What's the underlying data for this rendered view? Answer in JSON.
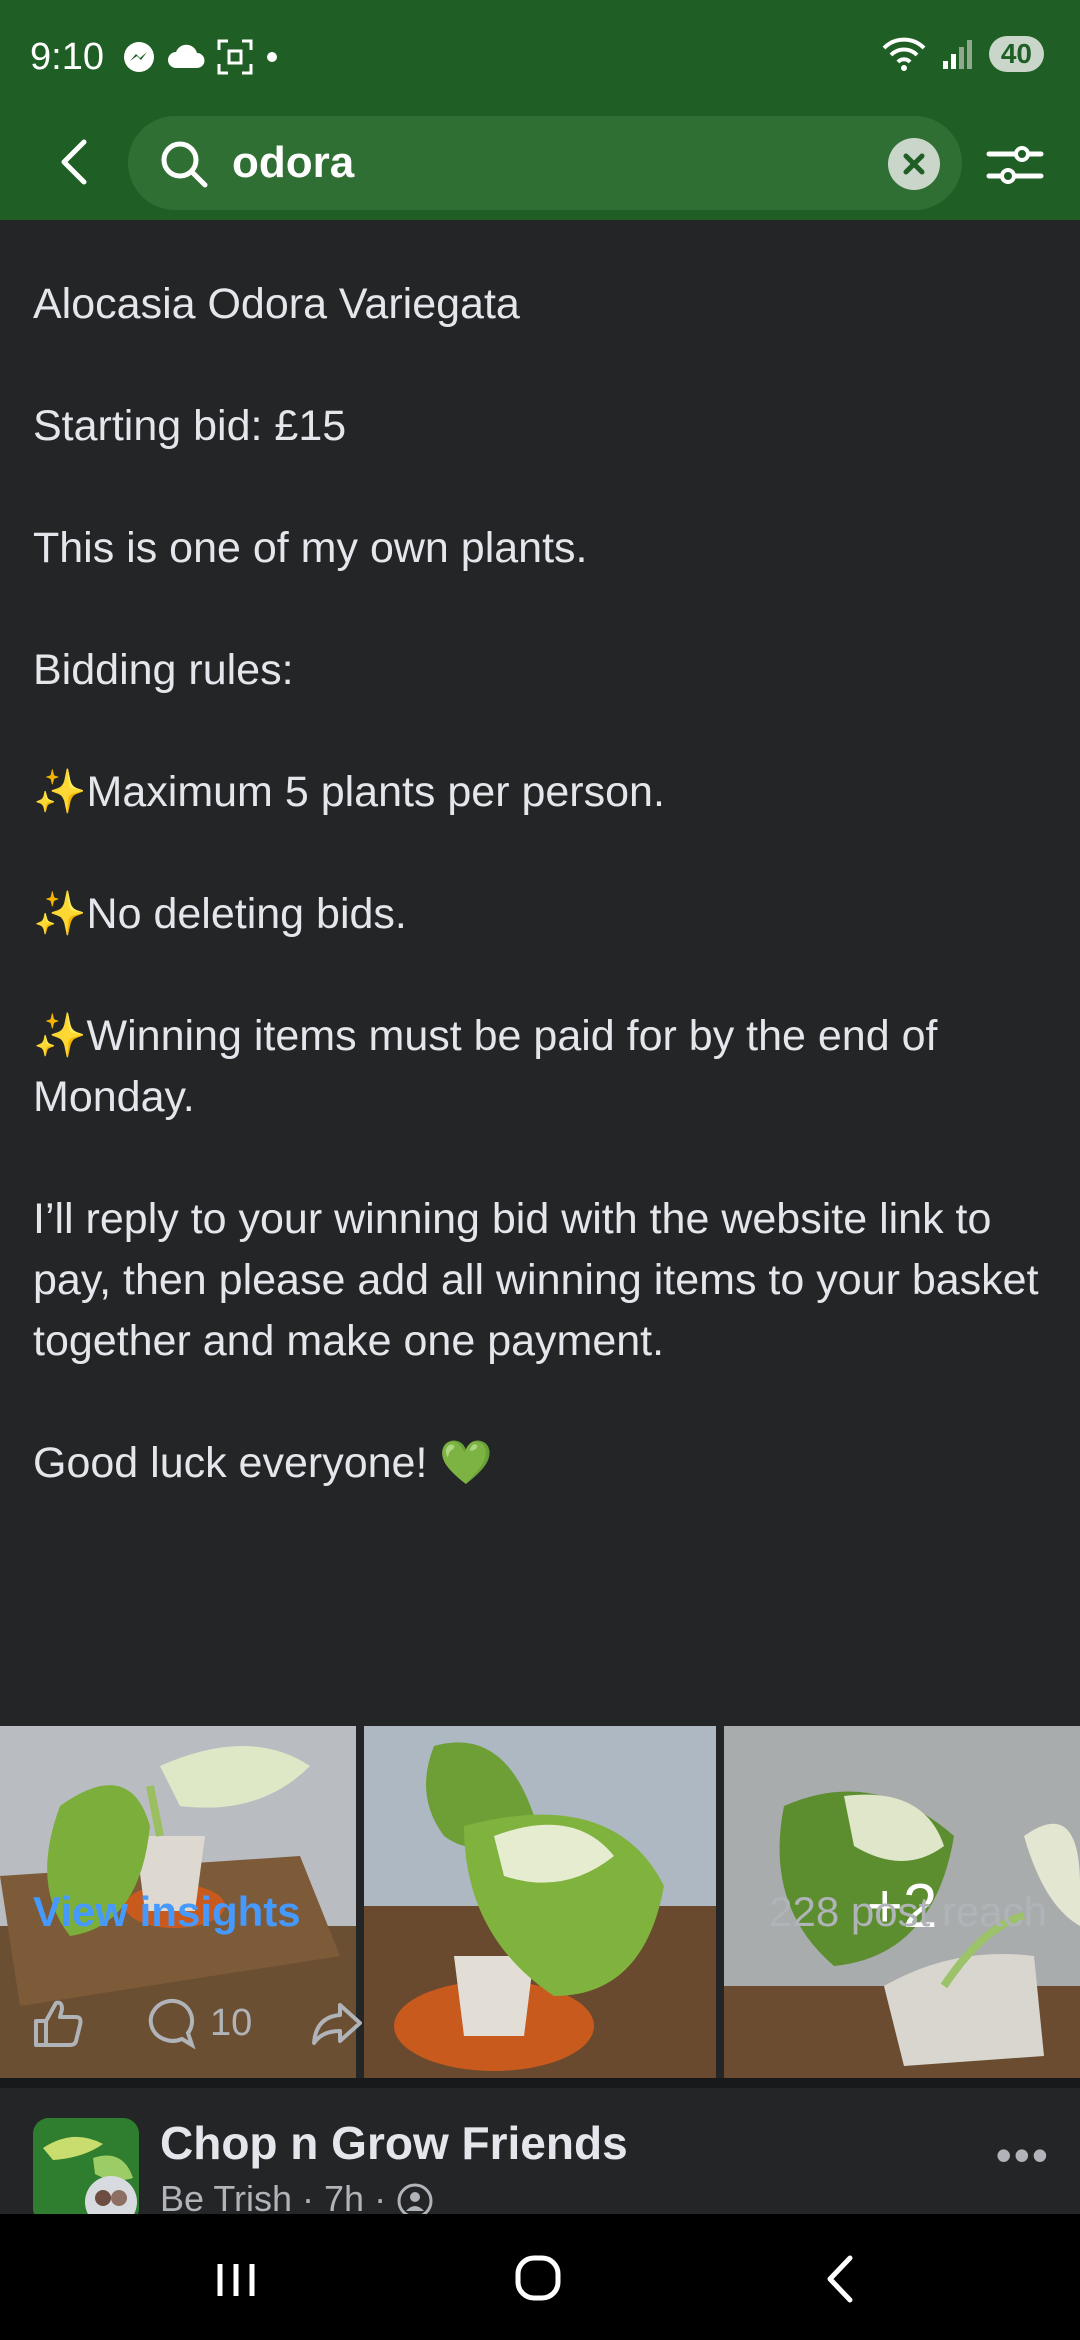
{
  "status": {
    "time": "9:10",
    "battery": "40"
  },
  "search": {
    "query": "odora"
  },
  "post": {
    "paragraphs": [
      "Alocasia Odora Variegata",
      "Starting bid: £15",
      "This is one of my own plants.",
      "Bidding rules:",
      "✨Maximum 5 plants per person.",
      "✨No deleting bids.",
      "✨Winning items must be paid for by the end of Monday.",
      "I’ll reply to your winning bid with the website link to pay, then please add all winning items to your basket together and make one payment.",
      "Good luck everyone! 💚"
    ],
    "more_photos": "+2",
    "view_insights": "View insights",
    "reach": "228 post reach",
    "comment_count": "10"
  },
  "next_post": {
    "group_name": "Chop n Grow Friends",
    "meta": "Be Trish · 7h ·",
    "more": "•••"
  },
  "colors": {
    "header": "#1f5e24",
    "background": "#242526",
    "link": "#4599ff"
  }
}
